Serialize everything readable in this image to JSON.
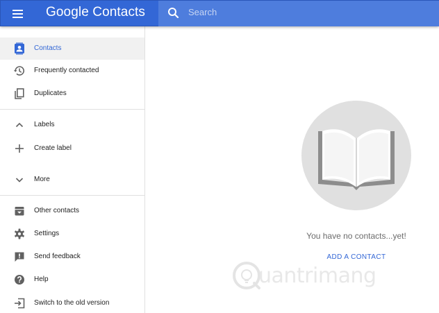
{
  "header": {
    "app_title": "Google Contacts",
    "search_placeholder": "Search"
  },
  "sidebar": {
    "items": [
      {
        "label": "Contacts",
        "icon": "contacts-icon",
        "active": true
      },
      {
        "label": "Frequently contacted",
        "icon": "history-icon",
        "active": false
      },
      {
        "label": "Duplicates",
        "icon": "duplicates-icon",
        "active": false
      },
      {
        "label": "Labels",
        "icon": "chevron-up-icon",
        "active": false
      },
      {
        "label": "Create label",
        "icon": "plus-icon",
        "active": false
      },
      {
        "label": "More",
        "icon": "chevron-down-icon",
        "active": false
      },
      {
        "label": "Other contacts",
        "icon": "archive-icon",
        "active": false
      },
      {
        "label": "Settings",
        "icon": "gear-icon",
        "active": false
      },
      {
        "label": "Send feedback",
        "icon": "feedback-icon",
        "active": false
      },
      {
        "label": "Help",
        "icon": "help-icon",
        "active": false
      },
      {
        "label": "Switch to the old version",
        "icon": "exit-icon",
        "active": false
      }
    ]
  },
  "main": {
    "empty_message": "You have no contacts...yet!",
    "add_contact_label": "ADD A CONTACT",
    "illustration": "open-book-icon"
  },
  "watermark": {
    "text": "uantrimang"
  },
  "colors": {
    "brand_blue": "#3367d6",
    "search_bg": "#4e7ddd",
    "active_bg": "#f1f1f1",
    "circle_bg": "#e0e0e0"
  }
}
